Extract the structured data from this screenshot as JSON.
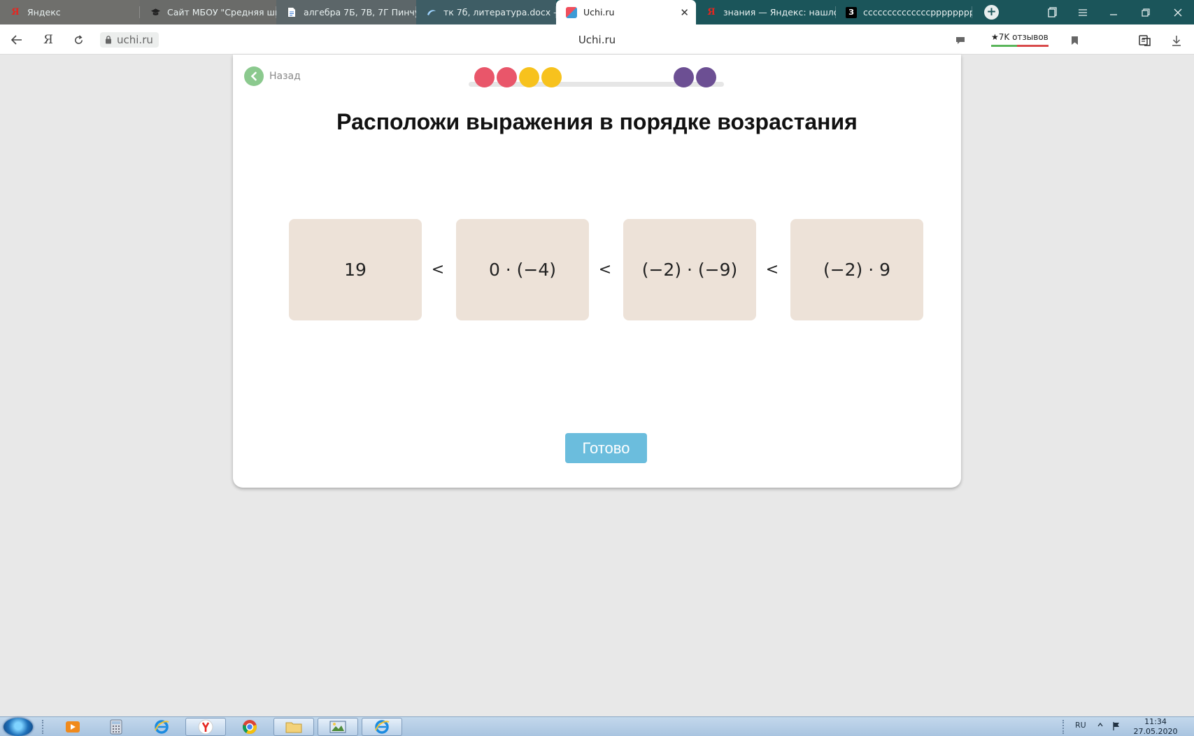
{
  "browser": {
    "tabs": [
      {
        "title": "Яндекс",
        "favicon": "yandex-logo-icon"
      },
      {
        "title": "Сайт МБОУ \"Средняя шко",
        "favicon": "graduation-cap-icon"
      },
      {
        "title": "алгебра 7Б, 7В, 7Г Пинчу",
        "favicon": "document-icon"
      },
      {
        "title": "тк 7б, литература.docx —",
        "favicon": "cloud-swirl-icon"
      },
      {
        "title": "Uchi.ru",
        "favicon": "uchi-logo-icon",
        "active": true,
        "close": "✕"
      },
      {
        "title": "знания — Яндекс: нашло",
        "favicon": "yandex-logo-icon"
      },
      {
        "title": "ccccccccccccccpppppppp",
        "favicon": "znaniya-logo-icon"
      }
    ],
    "favicon_glyphs": {
      "ya": "Я",
      "z": "З"
    },
    "new_tab": "+",
    "address": {
      "url": "uchi.ru",
      "page_title": "Uchi.ru",
      "yandex_button": "Я"
    },
    "reviews": "★7K отзывов"
  },
  "lesson": {
    "back_label": "Назад",
    "progress_dots": [
      {
        "color": "#e9566a"
      },
      {
        "color": "#e9566a"
      },
      {
        "color": "#f7c21d"
      },
      {
        "color": "#f7c21d"
      },
      {
        "color": "#6c4f93"
      },
      {
        "color": "#6c4f93"
      }
    ],
    "heading": "Расположи выражения в порядке возрастания",
    "tiles": [
      "19",
      "0 · (−4)",
      "(−2) · (−9)",
      "(−2) · 9"
    ],
    "separators": [
      "<",
      "<",
      "<"
    ],
    "done_label": "Готово"
  },
  "taskbar": {
    "language": "RU",
    "time": "11:34",
    "date": "27.05.2020"
  },
  "colors": {
    "tab_strip": "#1b555a",
    "tile_bg": "#ede2d8",
    "done_button": "#6bbddd",
    "back_circle": "#8bc98e"
  }
}
